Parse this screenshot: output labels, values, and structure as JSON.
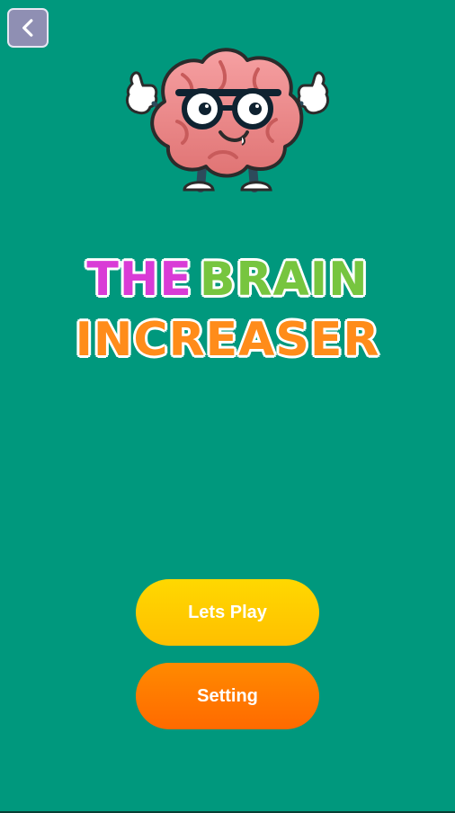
{
  "header": {
    "back_icon": "chevron-left-icon"
  },
  "hero": {
    "mascot_name": "brain-mascot"
  },
  "title": {
    "line1_word1": "THE",
    "line1_word2": "BRAIN",
    "line2_word1": "INCREASER"
  },
  "actions": {
    "play_label": "Lets Play",
    "setting_label": "Setting"
  },
  "theme": {
    "background": "#00987d",
    "purple": "#d93bd6",
    "green": "#77c53f",
    "orange": "#ff8c1a",
    "yellow_button": "#ffd800",
    "orange_button": "#ff7a00"
  }
}
